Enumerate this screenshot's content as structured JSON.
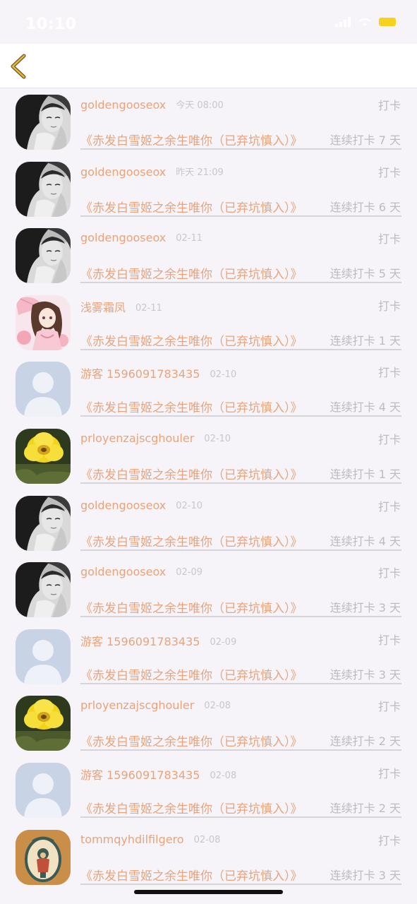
{
  "status_bar": {
    "time": "10:10",
    "battery_color": "#f6d21c"
  },
  "nav": {
    "back_icon": "chevron-left-icon",
    "accent_color": "#e8b73a"
  },
  "rows": [
    {
      "avatar": "portrait-bw",
      "username": "goldengooseox",
      "date": "今天 08:00",
      "action": "打卡",
      "book": "《赤发白雪姬之余生唯你（已弃坑慎入）》",
      "streak": "连续打卡 7 天"
    },
    {
      "avatar": "portrait-bw",
      "username": "goldengooseox",
      "date": "昨天 21:09",
      "action": "打卡",
      "book": "《赤发白雪姬之余生唯你（已弃坑慎入）》",
      "streak": "连续打卡 6 天"
    },
    {
      "avatar": "portrait-bw",
      "username": "goldengooseox",
      "date": "02-11",
      "action": "打卡",
      "book": "《赤发白雪姬之余生唯你（已弃坑慎入）》",
      "streak": "连续打卡 5 天"
    },
    {
      "avatar": "anime-girl",
      "username": "浅雾霜凤",
      "date": "02-11",
      "action": "打卡",
      "book": "《赤发白雪姬之余生唯你（已弃坑慎入）》",
      "streak": "连续打卡 1 天"
    },
    {
      "avatar": "default-user",
      "username": "游客 1596091783435",
      "date": "02-10",
      "action": "打卡",
      "book": "《赤发白雪姬之余生唯你（已弃坑慎入）》",
      "streak": "连续打卡 4 天"
    },
    {
      "avatar": "yellow-flower",
      "username": "prloyenzajscghouler",
      "date": "02-10",
      "action": "打卡",
      "book": "《赤发白雪姬之余生唯你（已弃坑慎入）》",
      "streak": "连续打卡 1 天"
    },
    {
      "avatar": "portrait-bw",
      "username": "goldengooseox",
      "date": "02-10",
      "action": "打卡",
      "book": "《赤发白雪姬之余生唯你（已弃坑慎入）》",
      "streak": "连续打卡 4 天"
    },
    {
      "avatar": "portrait-bw",
      "username": "goldengooseox",
      "date": "02-09",
      "action": "打卡",
      "book": "《赤发白雪姬之余生唯你（已弃坑慎入）》",
      "streak": "连续打卡 3 天"
    },
    {
      "avatar": "default-user",
      "username": "游客 1596091783435",
      "date": "02-09",
      "action": "打卡",
      "book": "《赤发白雪姬之余生唯你（已弃坑慎入）》",
      "streak": "连续打卡 3 天"
    },
    {
      "avatar": "yellow-flower",
      "username": "prloyenzajscghouler",
      "date": "02-08",
      "action": "打卡",
      "book": "《赤发白雪姬之余生唯你（已弃坑慎入）》",
      "streak": "连续打卡 2 天"
    },
    {
      "avatar": "default-user",
      "username": "游客 1596091783435",
      "date": "02-08",
      "action": "打卡",
      "book": "《赤发白雪姬之余生唯你（已弃坑慎入）》",
      "streak": "连续打卡 2 天"
    },
    {
      "avatar": "vintage-frame",
      "username": "tommqyhdilfilgero",
      "date": "02-08",
      "action": "打卡",
      "book": "《赤发白雪姬之余生唯你（已弃坑慎入）》",
      "streak": "连续打卡 3 天"
    }
  ],
  "colors": {
    "username": "#e9a37a",
    "meta": "#c9c6cc",
    "background": "#f6f4f8"
  }
}
